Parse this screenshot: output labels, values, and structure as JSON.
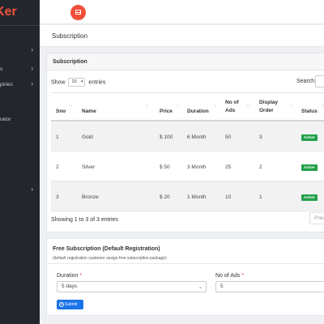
{
  "brand": "Ker",
  "sidebar": {
    "items": [
      {
        "label": "",
        "chevron": "›"
      },
      {
        "label": "s",
        "chevron": "›"
      },
      {
        "label": "gories",
        "chevron": "›"
      },
      {
        "label": "rator",
        "chevron": ""
      },
      {
        "label": "",
        "chevron": "›"
      }
    ]
  },
  "page": {
    "title": "Subscription"
  },
  "card": {
    "title": "Subscription",
    "show_label": "Show",
    "entries_value": "10",
    "entries_label": "entries",
    "search_label": "Search:",
    "showing_text": "Showing 1 to 3 of 3 entries",
    "prev_label": "Prev"
  },
  "table": {
    "headers": [
      "Sno",
      "Name",
      "Price",
      "Duration",
      "No of Ads",
      "Display Order",
      "Status"
    ],
    "rows": [
      {
        "sno": "1",
        "name": "Gold",
        "price": "$ 100",
        "duration": "6 Month",
        "ads": "50",
        "order": "3",
        "status": "Active"
      },
      {
        "sno": "2",
        "name": "Silver",
        "price": "$ 50",
        "duration": "3 Month",
        "ads": "25",
        "order": "2",
        "status": "Active"
      },
      {
        "sno": "3",
        "name": "Bronze",
        "price": "$ 20",
        "duration": "1 Month",
        "ads": "10",
        "order": "1",
        "status": "Active"
      }
    ]
  },
  "free": {
    "title": "Free Subscription (Default Registration)",
    "subtitle": "(default registration customer assign free subscription package)",
    "duration_label": "Duration",
    "duration_value": "5 days",
    "ads_label": "No of Ads",
    "ads_value": "5",
    "required_mark": "*",
    "submit_label": "Submit"
  },
  "colors": {
    "accent": "#f0503a",
    "sidebar": "#23272d",
    "active_badge": "#22a04b",
    "primary": "#1a73e8"
  }
}
